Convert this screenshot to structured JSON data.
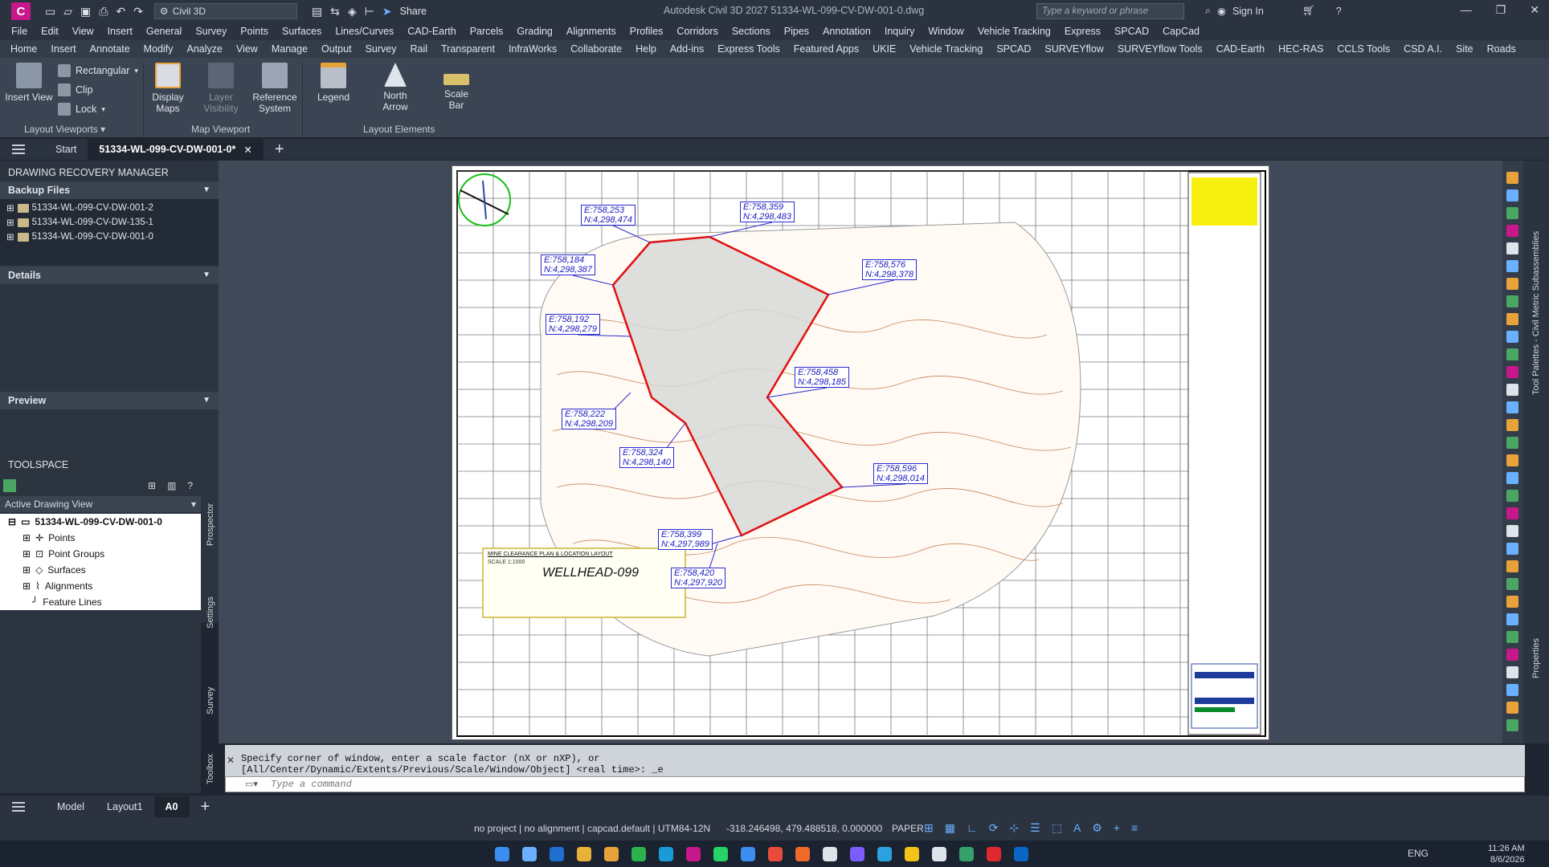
{
  "app": {
    "logo": "C",
    "workspace": "Civil 3D",
    "share": "Share",
    "title": "Autodesk Civil 3D 2027    51334-WL-099-CV-DW-001-0.dwg",
    "search_placeholder": "Type a keyword or phrase",
    "sign_in": "Sign In"
  },
  "menu": [
    "File",
    "Edit",
    "View",
    "Insert",
    "General",
    "Survey",
    "Points",
    "Surfaces",
    "Lines/Curves",
    "CAD-Earth",
    "Parcels",
    "Grading",
    "Alignments",
    "Profiles",
    "Corridors",
    "Sections",
    "Pipes",
    "Annotation",
    "Inquiry",
    "Window",
    "Vehicle Tracking",
    "Express",
    "SPCAD",
    "CapCad"
  ],
  "ribbon_tabs": [
    "Home",
    "Insert",
    "Annotate",
    "Modify",
    "Analyze",
    "View",
    "Manage",
    "Output",
    "Survey",
    "Rail",
    "Transparent",
    "InfraWorks",
    "Collaborate",
    "Help",
    "Add-ins",
    "Express Tools",
    "Featured Apps",
    "UKIE",
    "Vehicle Tracking",
    "SPCAD",
    "SURVEYflow",
    "SURVEYflow Tools",
    "CAD-Earth",
    "HEC-RAS",
    "CCLS Tools",
    "CSD A.I.",
    "Site",
    "Roads"
  ],
  "ribbon": {
    "insert_view": "Insert View",
    "rectangular": "Rectangular",
    "clip": "Clip",
    "lock": "Lock",
    "display_maps": "Display Maps",
    "layer_visibility": "Layer Visibility",
    "reference_system": "Reference System",
    "legend": "Legend",
    "north_arrow": "North Arrow",
    "scale_bar": "Scale Bar",
    "panel_layout_viewports": "Layout Viewports",
    "panel_map_viewport": "Map Viewport",
    "panel_layout_elements": "Layout Elements"
  },
  "file_tabs": {
    "start": "Start",
    "active": "51334-WL-099-CV-DW-001-0*"
  },
  "recovery": {
    "title": "DRAWING RECOVERY MANAGER",
    "backup_files": "Backup Files",
    "files": [
      "51334-WL-099-CV-DW-001-2",
      "51334-WL-099-CV-DW-135-1",
      "51334-WL-099-CV-DW-001-0"
    ],
    "details": "Details",
    "preview": "Preview"
  },
  "toolspace": {
    "title": "TOOLSPACE",
    "view_select": "Active Drawing View",
    "drawing": "51334-WL-099-CV-DW-001-0",
    "items": [
      "Points",
      "Point Groups",
      "Surfaces",
      "Alignments",
      "Feature Lines"
    ],
    "vtabs": [
      "Prospector",
      "Settings",
      "Survey",
      "Toolbox"
    ]
  },
  "drawing": {
    "title_block_heading": "MINE CLEARANCE PLAN & LOCATION LAYOUT",
    "scale": "SCALE 1:1000",
    "well": "WELLHEAD-099",
    "coords": [
      {
        "e": "E:758,253",
        "n": "N:4,298,474"
      },
      {
        "e": "E:758,359",
        "n": "N:4,298,483"
      },
      {
        "e": "E:758,184",
        "n": "N:4,298,387"
      },
      {
        "e": "E:758,576",
        "n": "N:4,298,378"
      },
      {
        "e": "E:758,192",
        "n": "N:4,298,279"
      },
      {
        "e": "E:758,458",
        "n": "N:4,298,185"
      },
      {
        "e": "E:758,222",
        "n": "N:4,298,209"
      },
      {
        "e": "E:758,324",
        "n": "N:4,298,140"
      },
      {
        "e": "E:758,596",
        "n": "N:4,298,014"
      },
      {
        "e": "E:758,399",
        "n": "N:4,297,989"
      },
      {
        "e": "E:758,420",
        "n": "N:4,297,920"
      }
    ]
  },
  "right_palettes": {
    "tool_palettes": "Tool Palettes - Civil Metric Subassemblies",
    "properties": "Properties"
  },
  "command": {
    "line1": "Specify corner of window, enter a scale factor (nX or nXP), or",
    "line2": "[All/Center/Dynamic/Extents/Previous/Scale/Window/Object] <real time>: _e",
    "placeholder": "Type a command"
  },
  "layout_tabs": [
    "Model",
    "Layout1",
    "A0"
  ],
  "status": {
    "context": "no project | no alignment | capcad.default | UTM84-12N",
    "coords": "-318.246498, 479.488518, 0.000000",
    "space": "PAPER"
  },
  "taskbar": {
    "lang": "ENG",
    "time": "11:26 AM",
    "date": "8/6/2026"
  }
}
